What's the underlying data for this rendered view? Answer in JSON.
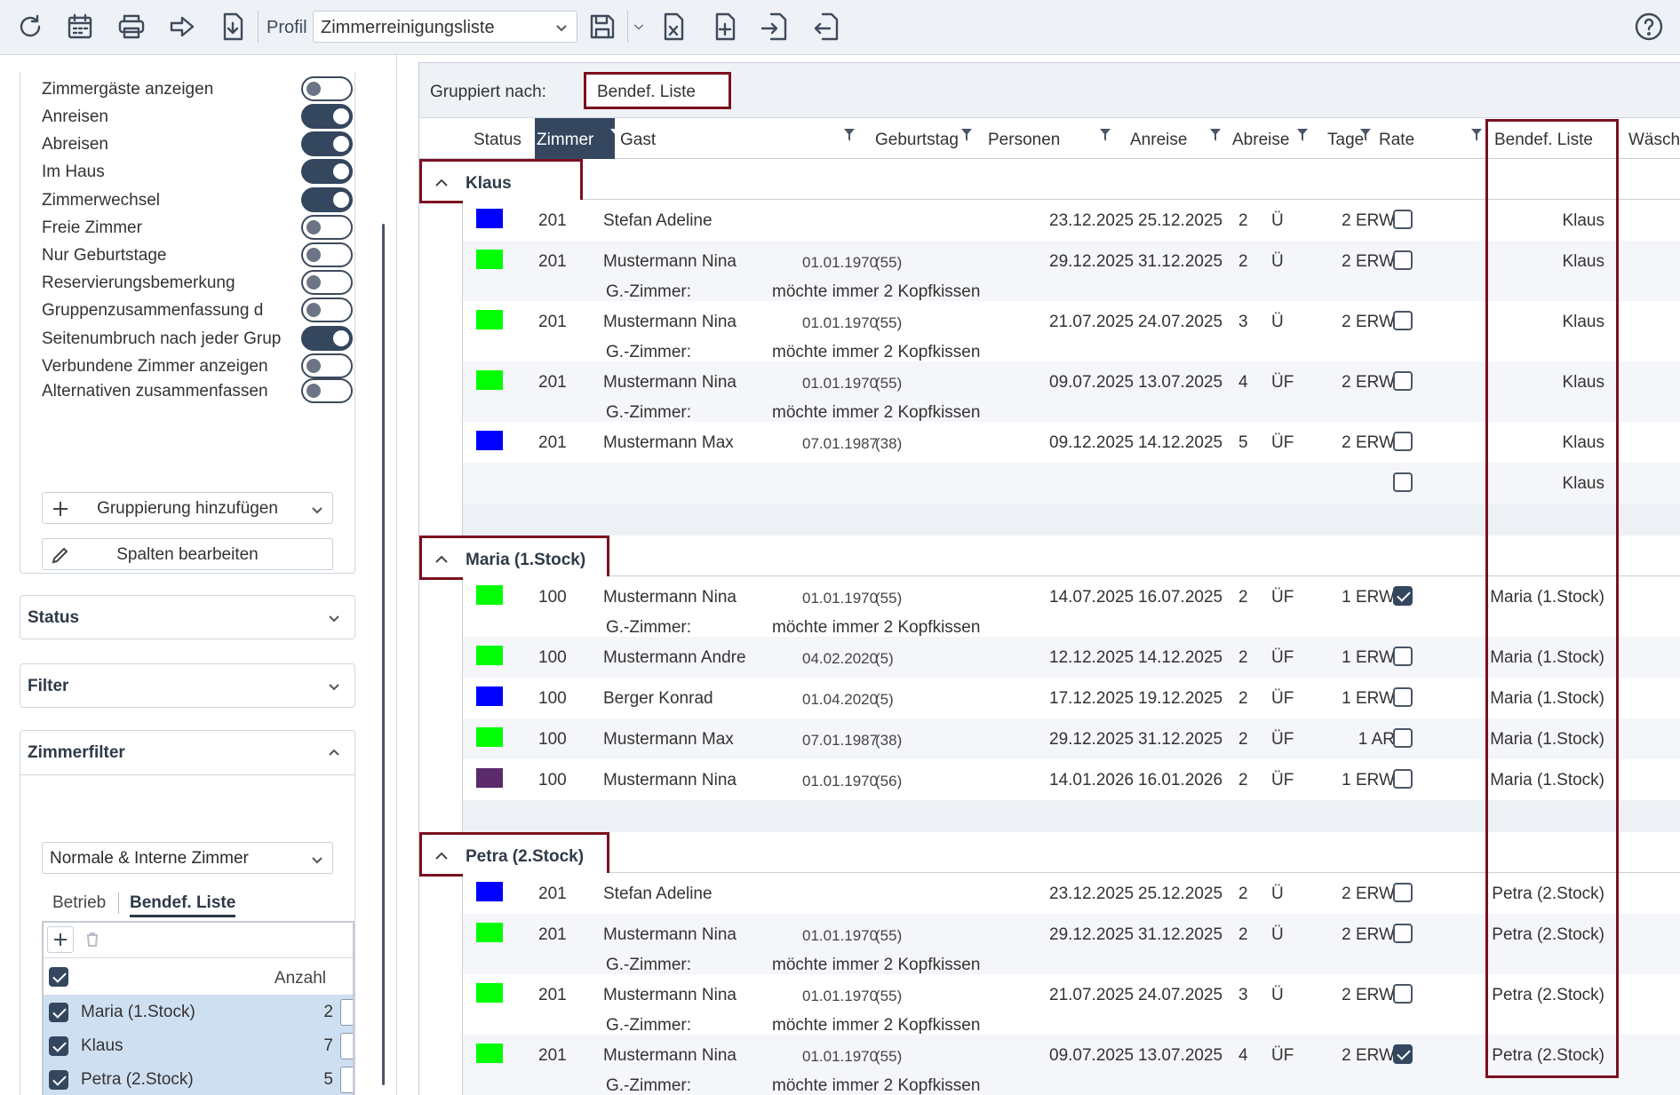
{
  "toolbar": {
    "profile_label": "Profil",
    "profile_value": "Zimmerreinigungsliste",
    "icons": [
      "refresh-icon",
      "calendar-icon",
      "print-icon",
      "forward-icon",
      "download-icon",
      "save-icon",
      "export-excel-icon",
      "add-page-icon",
      "import-icon",
      "export-icon",
      "help-icon"
    ]
  },
  "options": [
    {
      "label": "Zimmergäste anzeigen",
      "on": false
    },
    {
      "label": "Anreisen",
      "on": true
    },
    {
      "label": "Abreisen",
      "on": true
    },
    {
      "label": "Im Haus",
      "on": true
    },
    {
      "label": "Zimmerwechsel",
      "on": true
    },
    {
      "label": "Freie Zimmer",
      "on": false
    },
    {
      "label": "Nur Geburtstage",
      "on": false
    },
    {
      "label": "Reservierungsbemerkung",
      "on": false
    },
    {
      "label": "Gruppenzusammenfassung d",
      "on": false
    },
    {
      "label": "Seitenumbruch nach jeder Grup",
      "on": true
    },
    {
      "label": "Verbundene Zimmer anzeigen",
      "on": false
    },
    {
      "label": "Alternativen zusammenfassen",
      "on": false
    }
  ],
  "buttons": {
    "add_grouping": "Gruppierung hinzufügen",
    "edit_columns": "Spalten bearbeiten"
  },
  "accordions": {
    "status": "Status",
    "filter": "Filter",
    "zimmerfilter": "Zimmerfilter"
  },
  "zimmerfilter": {
    "select_value": "Normale & Interne Zimmer",
    "tabs": [
      "Betrieb",
      "Bendef. Liste"
    ],
    "head_label": "Anzahl",
    "rows": [
      {
        "name": "Maria (1.Stock)",
        "count": "2"
      },
      {
        "name": "Klaus",
        "count": "7"
      },
      {
        "name": "Petra (2.Stock)",
        "count": "5"
      }
    ]
  },
  "grouping": {
    "label": "Gruppiert nach:",
    "value": "Bendef. Liste"
  },
  "columns": [
    "Status",
    "Zimmer",
    "Gast",
    "Geburtstag",
    "Personen",
    "Anreise",
    "Abreise",
    "Tage",
    "Rate",
    "Bendef. Liste",
    "Wäsch"
  ],
  "colors": {
    "blue": "#0000ff",
    "green": "#00ff00",
    "purple": "#5a2a6a",
    "accent": "#34475f",
    "highlight": "#7b1020"
  },
  "groups": [
    {
      "name": "Klaus",
      "rows": [
        {
          "status": "blue",
          "zimmer": "201",
          "gast": "Stefan Adeline",
          "geb": "",
          "age": "",
          "pers": "2 ERW",
          "an": "23.12.2025",
          "ab": "25.12.2025",
          "tage": "2",
          "rate": "Ü",
          "liste": "Klaus",
          "check": false,
          "note": null
        },
        {
          "status": "green",
          "zimmer": "201",
          "gast": "Mustermann Nina",
          "geb": "01.01.1970",
          "age": "(55)",
          "pers": "2 ERW",
          "an": "29.12.2025",
          "ab": "31.12.2025",
          "tage": "2",
          "rate": "Ü",
          "liste": "Klaus",
          "check": false,
          "note": {
            "label": "G.-Zimmer:",
            "text": "möchte immer 2 Kopfkissen"
          }
        },
        {
          "status": "green",
          "zimmer": "201",
          "gast": "Mustermann Nina",
          "geb": "01.01.1970",
          "age": "(55)",
          "pers": "2 ERW",
          "an": "21.07.2025",
          "ab": "24.07.2025",
          "tage": "3",
          "rate": "Ü",
          "liste": "Klaus",
          "check": false,
          "note": {
            "label": "G.-Zimmer:",
            "text": "möchte immer 2 Kopfkissen"
          }
        },
        {
          "status": "green",
          "zimmer": "201",
          "gast": "Mustermann Nina",
          "geb": "01.01.1970",
          "age": "(55)",
          "pers": "2 ERW",
          "an": "09.07.2025",
          "ab": "13.07.2025",
          "tage": "4",
          "rate": "ÜF",
          "liste": "Klaus",
          "check": false,
          "note": {
            "label": "G.-Zimmer:",
            "text": "möchte immer 2 Kopfkissen"
          }
        },
        {
          "status": "blue",
          "zimmer": "201",
          "gast": "Mustermann Max",
          "geb": "07.01.1987",
          "age": "(38)",
          "pers": "2 ERW",
          "an": "09.12.2025",
          "ab": "14.12.2025",
          "tage": "5",
          "rate": "ÜF",
          "liste": "Klaus",
          "check": false,
          "note": null
        },
        {
          "status": "",
          "zimmer": "",
          "gast": "",
          "geb": "",
          "age": "",
          "pers": "",
          "an": "",
          "ab": "",
          "tage": "",
          "rate": "",
          "liste": "Klaus",
          "check": false,
          "note": null
        }
      ]
    },
    {
      "name": "Maria (1.Stock)",
      "rows": [
        {
          "status": "green",
          "zimmer": "100",
          "gast": "Mustermann Nina",
          "geb": "01.01.1970",
          "age": "(55)",
          "pers": "1 ERW",
          "an": "14.07.2025",
          "ab": "16.07.2025",
          "tage": "2",
          "rate": "ÜF",
          "liste": "Maria (1.Stock)",
          "check": true,
          "note": {
            "label": "G.-Zimmer:",
            "text": "möchte immer 2 Kopfkissen"
          }
        },
        {
          "status": "green",
          "zimmer": "100",
          "gast": "Mustermann Andre",
          "geb": "04.02.2020",
          "age": "(5)",
          "pers": "1 ERW",
          "an": "12.12.2025",
          "ab": "14.12.2025",
          "tage": "2",
          "rate": "ÜF",
          "liste": "Maria (1.Stock)",
          "check": false,
          "note": null
        },
        {
          "status": "blue",
          "zimmer": "100",
          "gast": "Berger Konrad",
          "geb": "01.04.2020",
          "age": "(5)",
          "pers": "1 ERW",
          "an": "17.12.2025",
          "ab": "19.12.2025",
          "tage": "2",
          "rate": "ÜF",
          "liste": "Maria (1.Stock)",
          "check": false,
          "note": null
        },
        {
          "status": "green",
          "zimmer": "100",
          "gast": "Mustermann Max",
          "geb": "07.01.1987",
          "age": "(38)",
          "pers": "1 AR",
          "an": "29.12.2025",
          "ab": "31.12.2025",
          "tage": "2",
          "rate": "ÜF",
          "liste": "Maria (1.Stock)",
          "check": false,
          "note": null
        },
        {
          "status": "purple",
          "zimmer": "100",
          "gast": "Mustermann Nina",
          "geb": "01.01.1970",
          "age": "(56)",
          "pers": "1 ERW",
          "an": "14.01.2026",
          "ab": "16.01.2026",
          "tage": "2",
          "rate": "ÜF",
          "liste": "Maria (1.Stock)",
          "check": false,
          "note": null
        }
      ]
    },
    {
      "name": "Petra (2.Stock)",
      "rows": [
        {
          "status": "blue",
          "zimmer": "201",
          "gast": "Stefan Adeline",
          "geb": "",
          "age": "",
          "pers": "2 ERW",
          "an": "23.12.2025",
          "ab": "25.12.2025",
          "tage": "2",
          "rate": "Ü",
          "liste": "Petra (2.Stock)",
          "check": false,
          "note": null
        },
        {
          "status": "green",
          "zimmer": "201",
          "gast": "Mustermann Nina",
          "geb": "01.01.1970",
          "age": "(55)",
          "pers": "2 ERW",
          "an": "29.12.2025",
          "ab": "31.12.2025",
          "tage": "2",
          "rate": "Ü",
          "liste": "Petra (2.Stock)",
          "check": false,
          "note": {
            "label": "G.-Zimmer:",
            "text": "möchte immer 2 Kopfkissen"
          }
        },
        {
          "status": "green",
          "zimmer": "201",
          "gast": "Mustermann Nina",
          "geb": "01.01.1970",
          "age": "(55)",
          "pers": "2 ERW",
          "an": "21.07.2025",
          "ab": "24.07.2025",
          "tage": "3",
          "rate": "Ü",
          "liste": "Petra (2.Stock)",
          "check": false,
          "note": {
            "label": "G.-Zimmer:",
            "text": "möchte immer 2 Kopfkissen"
          }
        },
        {
          "status": "green",
          "zimmer": "201",
          "gast": "Mustermann Nina",
          "geb": "01.01.1970",
          "age": "(55)",
          "pers": "2 ERW",
          "an": "09.07.2025",
          "ab": "13.07.2025",
          "tage": "4",
          "rate": "ÜF",
          "liste": "Petra (2.Stock)",
          "check": true,
          "note": {
            "label": "G.-Zimmer:",
            "text": "möchte immer 2 Kopfkissen"
          }
        }
      ]
    }
  ]
}
